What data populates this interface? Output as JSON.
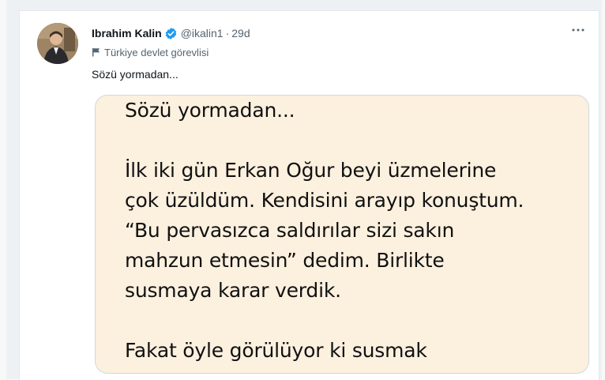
{
  "tweet": {
    "author_name": "Ibrahim Kalin",
    "handle": "@ikalin1",
    "separator": "·",
    "time": "29d",
    "account_label": "Türkiye devlet görevlisi",
    "text": "Sözü yormadan...",
    "more_icon": "more-horizontal-icon",
    "verified_icon": "verified-badge-icon",
    "label_icon": "flag-icon"
  },
  "media": {
    "lines": [
      "Sözü yormadan...",
      "",
      "İlk iki gün Erkan Oğur beyi üzmelerine",
      "çok üzüldüm. Kendisini arayıp konuştum.",
      "“Bu pervasızca saldırılar sizi sakın",
      "mahzun etmesin” dedim. Birlikte",
      "susmaya karar verdik.",
      "",
      "Fakat öyle görülüyor ki susmak"
    ]
  },
  "colors": {
    "verified": "#1d9bf0",
    "secondary_text": "#536471",
    "media_background": "#fcf0df"
  }
}
